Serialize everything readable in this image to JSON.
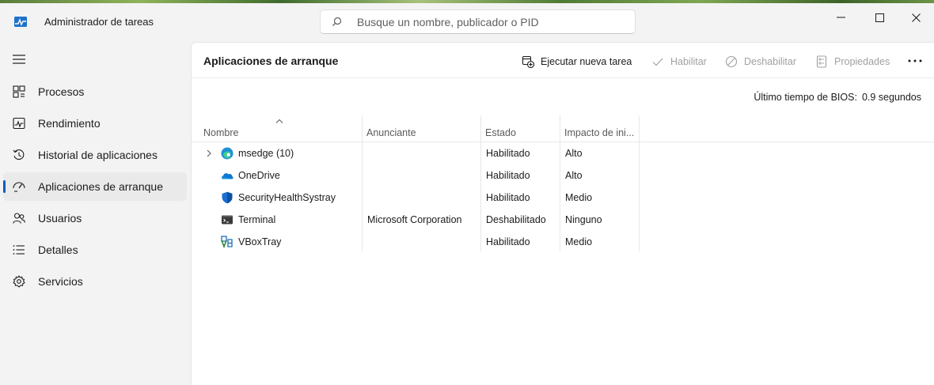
{
  "window": {
    "title": "Administrador de tareas",
    "search_placeholder": "Busque un nombre, publicador o PID"
  },
  "sidebar": {
    "items": [
      {
        "label": "Procesos",
        "icon": "processes-icon"
      },
      {
        "label": "Rendimiento",
        "icon": "performance-icon"
      },
      {
        "label": "Historial de aplicaciones",
        "icon": "app-history-icon"
      },
      {
        "label": "Aplicaciones de arranque",
        "icon": "startup-apps-icon",
        "active": true
      },
      {
        "label": "Usuarios",
        "icon": "users-icon"
      },
      {
        "label": "Detalles",
        "icon": "details-icon"
      },
      {
        "label": "Servicios",
        "icon": "services-icon"
      }
    ]
  },
  "main": {
    "title": "Aplicaciones de arranque",
    "toolbar": {
      "run_task": "Ejecutar nueva tarea",
      "enable": "Habilitar",
      "disable": "Deshabilitar",
      "properties": "Propiedades"
    },
    "bios_label": "Último tiempo de BIOS:",
    "bios_value": "0.9 segundos",
    "columns": [
      "Nombre",
      "Anunciante",
      "Estado",
      "Impacto de ini..."
    ],
    "rows": [
      {
        "name": "msedge (10)",
        "publisher": "",
        "status": "Habilitado",
        "impact": "Alto",
        "icon": "edge-icon",
        "expandable": true
      },
      {
        "name": "OneDrive",
        "publisher": "",
        "status": "Habilitado",
        "impact": "Alto",
        "icon": "onedrive-icon"
      },
      {
        "name": "SecurityHealthSystray",
        "publisher": "",
        "status": "Habilitado",
        "impact": "Medio",
        "icon": "security-shield-icon"
      },
      {
        "name": "Terminal",
        "publisher": "Microsoft Corporation",
        "status": "Deshabilitado",
        "impact": "Ninguno",
        "icon": "terminal-icon"
      },
      {
        "name": "VBoxTray",
        "publisher": "",
        "status": "Habilitado",
        "impact": "Medio",
        "icon": "vbox-icon"
      }
    ]
  },
  "colors": {
    "accent": "#005fb8",
    "background": "#f3f3f3",
    "content": "#ffffff"
  }
}
